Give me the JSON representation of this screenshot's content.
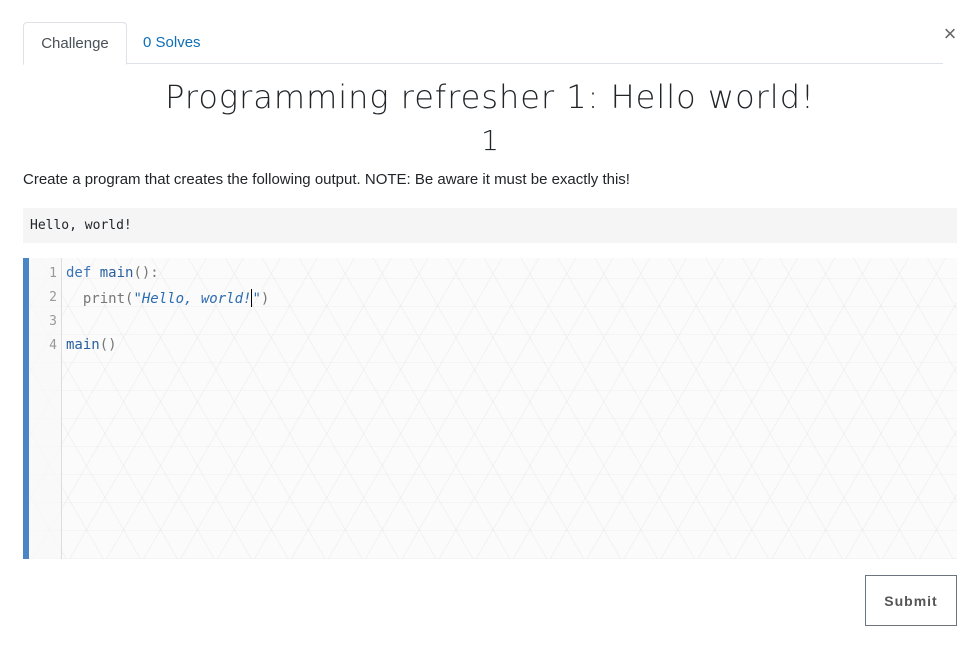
{
  "tabs": [
    {
      "label": "Challenge",
      "active": true
    },
    {
      "label": "0 Solves",
      "active": false
    }
  ],
  "close_label": "×",
  "challenge": {
    "title": "Programming refresher 1: Hello world!",
    "value": "1",
    "description": "Create a program that creates the following output. NOTE: Be aware it must be exactly this!",
    "expected_output": "Hello, world!"
  },
  "editor": {
    "line_numbers": [
      "1",
      "2",
      "3",
      "4"
    ],
    "line1": {
      "kw": "def",
      "fn": "main",
      "punct": "():"
    },
    "line2": {
      "indent": "  ",
      "fn": "print",
      "open": "(",
      "str": "\"Hello, world!",
      "str_close": "\"",
      "close": ")"
    },
    "line4": {
      "fn": "main",
      "punct": "()"
    }
  },
  "submit_label": "Submit",
  "colors": {
    "accent": "#4a86c5",
    "link": "#0e6eb8"
  }
}
